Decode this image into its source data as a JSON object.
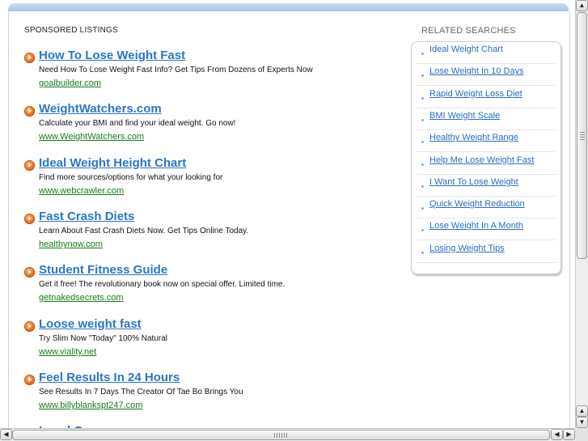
{
  "sponsored": {
    "heading": "SPONSORED LISTINGS",
    "listings": [
      {
        "title": "How To Lose Weight Fast",
        "desc": "Need How To Lose Weight Fast Info? Get Tips From Dozens of Experts Now",
        "url": "goalbuilder.com"
      },
      {
        "title": "WeightWatchers.com",
        "desc": "Calculate your BMI and find your ideal weight. Go now!",
        "url": "www.WeightWatchers.com"
      },
      {
        "title": "Ideal Weight Height Chart",
        "desc": "Find more sources/options for what your looking for",
        "url": "www.webcrawler.com"
      },
      {
        "title": "Fast Crash Diets",
        "desc": "Learn About Fast Crash Diets Now. Get Tips Online Today.",
        "url": "healthynow.com"
      },
      {
        "title": "Student Fitness Guide",
        "desc": "Get it free! The revolutionary book now on special offer. Limited time.",
        "url": "getnakedsecrets.com"
      },
      {
        "title": "Loose weight fast",
        "desc": "Try Slim Now \"Today\" 100% Natural",
        "url": "www.viality.net"
      },
      {
        "title": "Feel Results In 24 Hours",
        "desc": "See Results In 7 Days The Creator Of Tae Bo Brings You",
        "url": "www.billyblankspt247.com"
      },
      {
        "title": "Local Coupons",
        "desc": "",
        "url": ""
      }
    ]
  },
  "related": {
    "heading": "RELATED SEARCHES",
    "bullet": "▪",
    "items": [
      "Ideal Weight Chart",
      "Lose Weight In 10 Days",
      "Rapid Weight Loss Diet",
      "BMI Weight Scale",
      "Healthy Weight Range",
      "Help Me Lose Weight Fast",
      "I Want To Lose Weight",
      "Quick Weight Reduction",
      "Lose Weight In A Month",
      "Losing Weight Tips"
    ]
  },
  "scrollbars": {
    "up_arrow": "▲",
    "down_arrow": "▼",
    "left_arrow": "◀",
    "right_arrow": "▶"
  },
  "colors": {
    "link_blue": "#2a76c6",
    "url_green": "#1a7a1a",
    "bullet_orange": "#e2620f",
    "header_bar": "#9dbfe3"
  }
}
